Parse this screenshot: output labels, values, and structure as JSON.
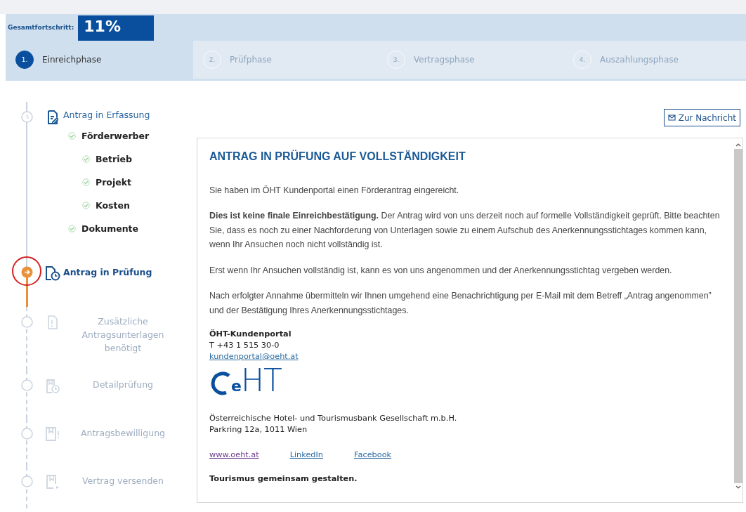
{
  "progress": {
    "label": "Gesamtfortschritt:",
    "value": "11%"
  },
  "phases": [
    {
      "number": "1.",
      "label": "Einreichphase",
      "selected": true
    },
    {
      "number": "2.",
      "label": "Prüfphase",
      "selected": false
    },
    {
      "number": "3.",
      "label": "Vertragsphase",
      "selected": false
    },
    {
      "number": "4.",
      "label": "Auszahlungsphase",
      "selected": false
    }
  ],
  "timeline": [
    {
      "label": "Antrag in Erfassung",
      "kind": "done",
      "children": [
        {
          "label": "Förderwerber",
          "checked": true,
          "children": [
            {
              "label": "Betrieb",
              "checked": true
            },
            {
              "label": "Projekt",
              "checked": true
            },
            {
              "label": "Kosten",
              "checked": true
            }
          ]
        },
        {
          "label": "Dokumente",
          "checked": true
        }
      ]
    },
    {
      "label": "Antrag in Prüfung",
      "kind": "current"
    },
    {
      "label": "Zusätzliche Antragsunterlagen benötigt",
      "kind": "pending"
    },
    {
      "label": "Detailprüfung",
      "kind": "pending"
    },
    {
      "label": "Antragsbewilligung",
      "kind": "pending"
    },
    {
      "label": "Vertrag versenden",
      "kind": "pending"
    }
  ],
  "message_button": "Zur Nachricht",
  "message": {
    "title": "ANTRAG IN PRÜFUNG AUF VOLLSTÄNDIGKEIT",
    "paragraphs": [
      "Sie haben im ÖHT Kundenportal einen Förderantrag eingereicht.",
      "**Dies ist keine finale Einreichbestätigung.** Der Antrag wird von uns derzeit noch auf formelle Vollständigkeit geprüft. Bitte beachten Sie, dass es noch zu einer Nachforderung von Unterlagen sowie zu einem Aufschub des Anerkennungsstichtages kommen kann, wenn Ihr Ansuchen noch nicht vollständig ist.",
      "Erst wenn Ihr Ansuchen vollständig ist, kann es von uns angenommen und der Anerkennungsstichtag vergeben werden.",
      "Nach erfolgter Annahme übermitteln wir Ihnen umgehend eine Benachrichtigung per E-Mail mit dem Betreff „Antrag angenommen” und der Bestätigung Ihres Anerkennungsstichtages."
    ],
    "signature": {
      "name": "ÖHT-Kundenportal",
      "phone": "T +43 1 515 30-0",
      "email": "kundenportal@oeht.at",
      "logo": "eHT",
      "company": "Österreichische Hotel- und Tourismusbank Gesellschaft m.b.H.",
      "address": "Parkring 12a, 1011 Wien",
      "links": [
        {
          "label": "www.oeht.at",
          "visited": true
        },
        {
          "label": "LinkedIn",
          "visited": false
        },
        {
          "label": "Facebook",
          "visited": false
        }
      ],
      "tagline": "Tourismus gemeinsam gestalten."
    }
  }
}
